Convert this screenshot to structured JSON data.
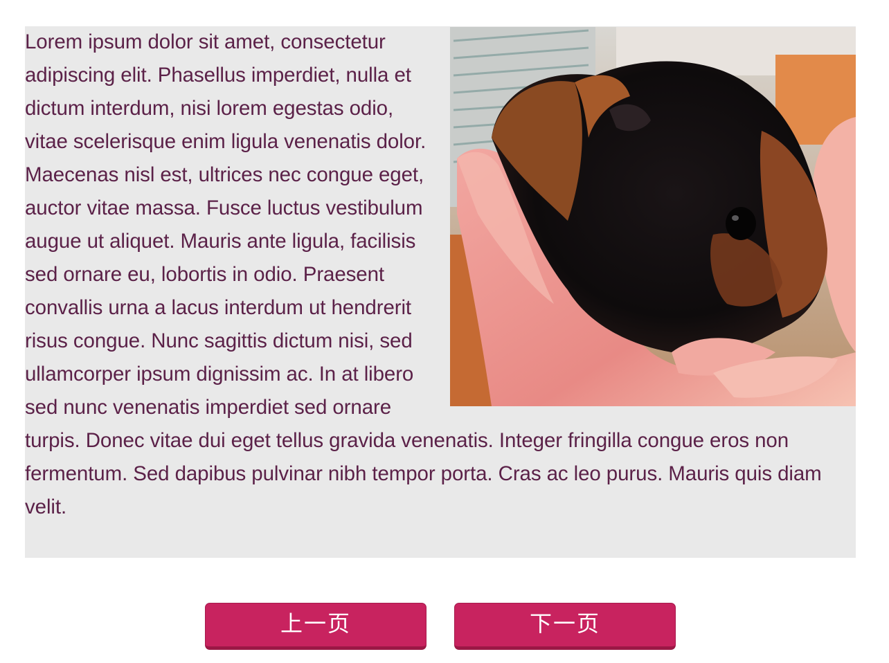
{
  "article": {
    "text": "Lorem ipsum dolor sit amet, consectetur adipiscing elit. Phasellus imperdiet, nulla et dictum interdum, nisi lorem egestas odio, vitae scelerisque enim ligula venenatis dolor. Maecenas nisl est, ultrices nec congue eget, auctor vitae massa. Fusce luctus vestibulum augue ut aliquet. Mauris ante ligula, facilisis sed ornare eu, lobortis in odio. Praesent convallis urna a lacus interdum ut hendrerit risus congue. Nunc sagittis dictum nisi, sed ullamcorper ipsum dignissim ac. In at libero sed nunc venenatis imperdiet sed ornare turpis. Donec vitae dui eget tellus gravida venenatis. Integer fringilla congue eros non fermentum. Sed dapibus pulvinar nibh tempor porta. Cras ac leo purus. Mauris quis diam velit."
  },
  "pagination": {
    "prev_label": "上一页",
    "next_label": "下一页"
  },
  "colors": {
    "text": "#5b2148",
    "panel_background": "#e9e9e9",
    "button": "#c8235f"
  }
}
